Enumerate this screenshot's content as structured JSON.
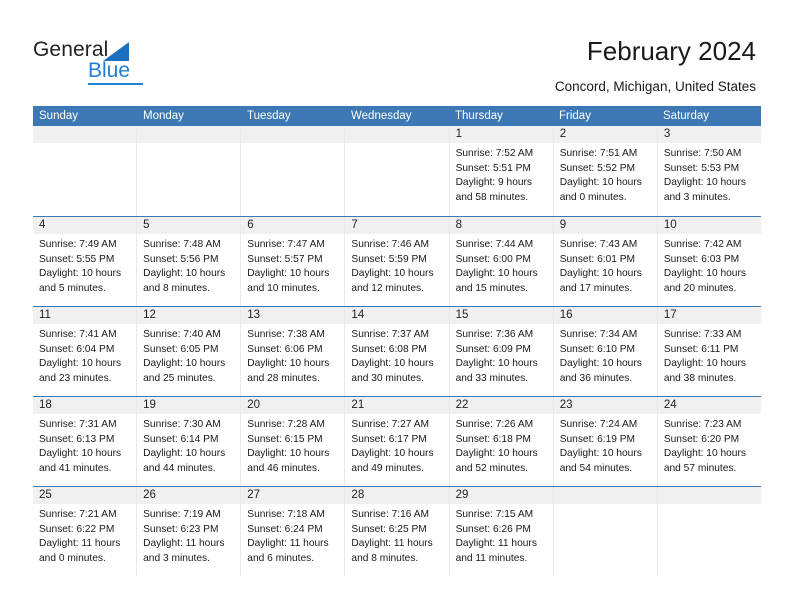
{
  "brand": {
    "name_part1": "General",
    "name_part2": "Blue",
    "triangle_color": "#1f6fc0",
    "blue_color": "#1f7fd0"
  },
  "header": {
    "title": "February 2024",
    "subtitle": "Concord, Michigan, United States",
    "header_bg": "#3b78b4",
    "daynum_bg": "#f0f0f0"
  },
  "weekdays": [
    "Sunday",
    "Monday",
    "Tuesday",
    "Wednesday",
    "Thursday",
    "Friday",
    "Saturday"
  ],
  "labels": {
    "sunrise": "Sunrise:",
    "sunset": "Sunset:",
    "daylight": "Daylight:"
  },
  "weeks": [
    [
      {
        "day": "",
        "empty": true
      },
      {
        "day": "",
        "empty": true
      },
      {
        "day": "",
        "empty": true
      },
      {
        "day": "",
        "empty": true
      },
      {
        "day": "1",
        "sunrise": "Sunrise: 7:52 AM",
        "sunset": "Sunset: 5:51 PM",
        "daylight1": "Daylight: 9 hours",
        "daylight2": "and 58 minutes."
      },
      {
        "day": "2",
        "sunrise": "Sunrise: 7:51 AM",
        "sunset": "Sunset: 5:52 PM",
        "daylight1": "Daylight: 10 hours",
        "daylight2": "and 0 minutes."
      },
      {
        "day": "3",
        "sunrise": "Sunrise: 7:50 AM",
        "sunset": "Sunset: 5:53 PM",
        "daylight1": "Daylight: 10 hours",
        "daylight2": "and 3 minutes."
      }
    ],
    [
      {
        "day": "4",
        "sunrise": "Sunrise: 7:49 AM",
        "sunset": "Sunset: 5:55 PM",
        "daylight1": "Daylight: 10 hours",
        "daylight2": "and 5 minutes."
      },
      {
        "day": "5",
        "sunrise": "Sunrise: 7:48 AM",
        "sunset": "Sunset: 5:56 PM",
        "daylight1": "Daylight: 10 hours",
        "daylight2": "and 8 minutes."
      },
      {
        "day": "6",
        "sunrise": "Sunrise: 7:47 AM",
        "sunset": "Sunset: 5:57 PM",
        "daylight1": "Daylight: 10 hours",
        "daylight2": "and 10 minutes."
      },
      {
        "day": "7",
        "sunrise": "Sunrise: 7:46 AM",
        "sunset": "Sunset: 5:59 PM",
        "daylight1": "Daylight: 10 hours",
        "daylight2": "and 12 minutes."
      },
      {
        "day": "8",
        "sunrise": "Sunrise: 7:44 AM",
        "sunset": "Sunset: 6:00 PM",
        "daylight1": "Daylight: 10 hours",
        "daylight2": "and 15 minutes."
      },
      {
        "day": "9",
        "sunrise": "Sunrise: 7:43 AM",
        "sunset": "Sunset: 6:01 PM",
        "daylight1": "Daylight: 10 hours",
        "daylight2": "and 17 minutes."
      },
      {
        "day": "10",
        "sunrise": "Sunrise: 7:42 AM",
        "sunset": "Sunset: 6:03 PM",
        "daylight1": "Daylight: 10 hours",
        "daylight2": "and 20 minutes."
      }
    ],
    [
      {
        "day": "11",
        "sunrise": "Sunrise: 7:41 AM",
        "sunset": "Sunset: 6:04 PM",
        "daylight1": "Daylight: 10 hours",
        "daylight2": "and 23 minutes."
      },
      {
        "day": "12",
        "sunrise": "Sunrise: 7:40 AM",
        "sunset": "Sunset: 6:05 PM",
        "daylight1": "Daylight: 10 hours",
        "daylight2": "and 25 minutes."
      },
      {
        "day": "13",
        "sunrise": "Sunrise: 7:38 AM",
        "sunset": "Sunset: 6:06 PM",
        "daylight1": "Daylight: 10 hours",
        "daylight2": "and 28 minutes."
      },
      {
        "day": "14",
        "sunrise": "Sunrise: 7:37 AM",
        "sunset": "Sunset: 6:08 PM",
        "daylight1": "Daylight: 10 hours",
        "daylight2": "and 30 minutes."
      },
      {
        "day": "15",
        "sunrise": "Sunrise: 7:36 AM",
        "sunset": "Sunset: 6:09 PM",
        "daylight1": "Daylight: 10 hours",
        "daylight2": "and 33 minutes."
      },
      {
        "day": "16",
        "sunrise": "Sunrise: 7:34 AM",
        "sunset": "Sunset: 6:10 PM",
        "daylight1": "Daylight: 10 hours",
        "daylight2": "and 36 minutes."
      },
      {
        "day": "17",
        "sunrise": "Sunrise: 7:33 AM",
        "sunset": "Sunset: 6:11 PM",
        "daylight1": "Daylight: 10 hours",
        "daylight2": "and 38 minutes."
      }
    ],
    [
      {
        "day": "18",
        "sunrise": "Sunrise: 7:31 AM",
        "sunset": "Sunset: 6:13 PM",
        "daylight1": "Daylight: 10 hours",
        "daylight2": "and 41 minutes."
      },
      {
        "day": "19",
        "sunrise": "Sunrise: 7:30 AM",
        "sunset": "Sunset: 6:14 PM",
        "daylight1": "Daylight: 10 hours",
        "daylight2": "and 44 minutes."
      },
      {
        "day": "20",
        "sunrise": "Sunrise: 7:28 AM",
        "sunset": "Sunset: 6:15 PM",
        "daylight1": "Daylight: 10 hours",
        "daylight2": "and 46 minutes."
      },
      {
        "day": "21",
        "sunrise": "Sunrise: 7:27 AM",
        "sunset": "Sunset: 6:17 PM",
        "daylight1": "Daylight: 10 hours",
        "daylight2": "and 49 minutes."
      },
      {
        "day": "22",
        "sunrise": "Sunrise: 7:26 AM",
        "sunset": "Sunset: 6:18 PM",
        "daylight1": "Daylight: 10 hours",
        "daylight2": "and 52 minutes."
      },
      {
        "day": "23",
        "sunrise": "Sunrise: 7:24 AM",
        "sunset": "Sunset: 6:19 PM",
        "daylight1": "Daylight: 10 hours",
        "daylight2": "and 54 minutes."
      },
      {
        "day": "24",
        "sunrise": "Sunrise: 7:23 AM",
        "sunset": "Sunset: 6:20 PM",
        "daylight1": "Daylight: 10 hours",
        "daylight2": "and 57 minutes."
      }
    ],
    [
      {
        "day": "25",
        "sunrise": "Sunrise: 7:21 AM",
        "sunset": "Sunset: 6:22 PM",
        "daylight1": "Daylight: 11 hours",
        "daylight2": "and 0 minutes."
      },
      {
        "day": "26",
        "sunrise": "Sunrise: 7:19 AM",
        "sunset": "Sunset: 6:23 PM",
        "daylight1": "Daylight: 11 hours",
        "daylight2": "and 3 minutes."
      },
      {
        "day": "27",
        "sunrise": "Sunrise: 7:18 AM",
        "sunset": "Sunset: 6:24 PM",
        "daylight1": "Daylight: 11 hours",
        "daylight2": "and 6 minutes."
      },
      {
        "day": "28",
        "sunrise": "Sunrise: 7:16 AM",
        "sunset": "Sunset: 6:25 PM",
        "daylight1": "Daylight: 11 hours",
        "daylight2": "and 8 minutes."
      },
      {
        "day": "29",
        "sunrise": "Sunrise: 7:15 AM",
        "sunset": "Sunset: 6:26 PM",
        "daylight1": "Daylight: 11 hours",
        "daylight2": "and 11 minutes."
      },
      {
        "day": "",
        "empty": true
      },
      {
        "day": "",
        "empty": true
      }
    ]
  ]
}
